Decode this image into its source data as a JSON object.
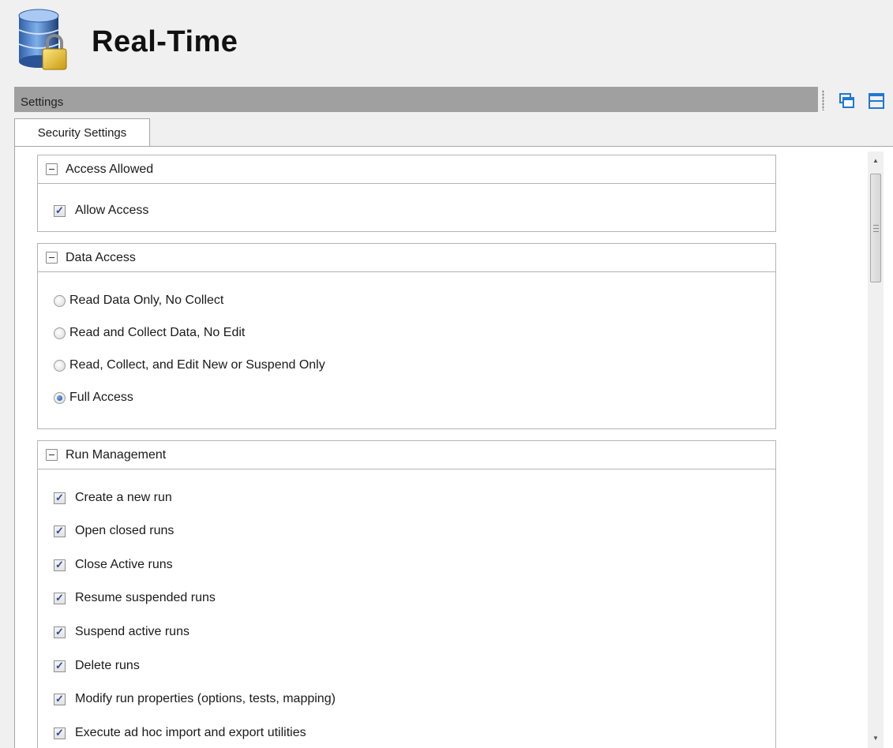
{
  "header": {
    "title": "Real-Time",
    "icon": "database-lock-icon"
  },
  "settings_bar": {
    "label": "Settings",
    "buttons": [
      {
        "icon": "restore-window-icon"
      },
      {
        "icon": "split-panel-icon"
      }
    ]
  },
  "tabs": [
    {
      "label": "Security Settings",
      "active": true
    }
  ],
  "groups": {
    "access_allowed": {
      "title": "Access Allowed",
      "items": [
        {
          "label": "Allow Access",
          "checked": true
        }
      ]
    },
    "data_access": {
      "title": "Data Access",
      "options": [
        {
          "label": "Read Data Only, No Collect",
          "selected": false
        },
        {
          "label": "Read and Collect Data, No Edit",
          "selected": false
        },
        {
          "label": "Read, Collect, and Edit New or Suspend Only",
          "selected": false
        },
        {
          "label": "Full Access",
          "selected": true
        }
      ]
    },
    "run_management": {
      "title": "Run Management",
      "items": [
        {
          "label": "Create a new run",
          "checked": true
        },
        {
          "label": "Open closed runs",
          "checked": true
        },
        {
          "label": "Close Active runs",
          "checked": true
        },
        {
          "label": "Resume suspended runs",
          "checked": true
        },
        {
          "label": "Suspend active runs",
          "checked": true
        },
        {
          "label": "Delete runs",
          "checked": true
        },
        {
          "label": "Modify run properties (options, tests, mapping)",
          "checked": true
        },
        {
          "label": "Execute ad hoc import and export utilities",
          "checked": true
        }
      ]
    }
  },
  "colors": {
    "settings_bar_bg": "#a0a0a0",
    "check_mark": "#2a4a9a",
    "radio_dot": "#1f4f9e",
    "icon_blue": "#1e78d4"
  }
}
